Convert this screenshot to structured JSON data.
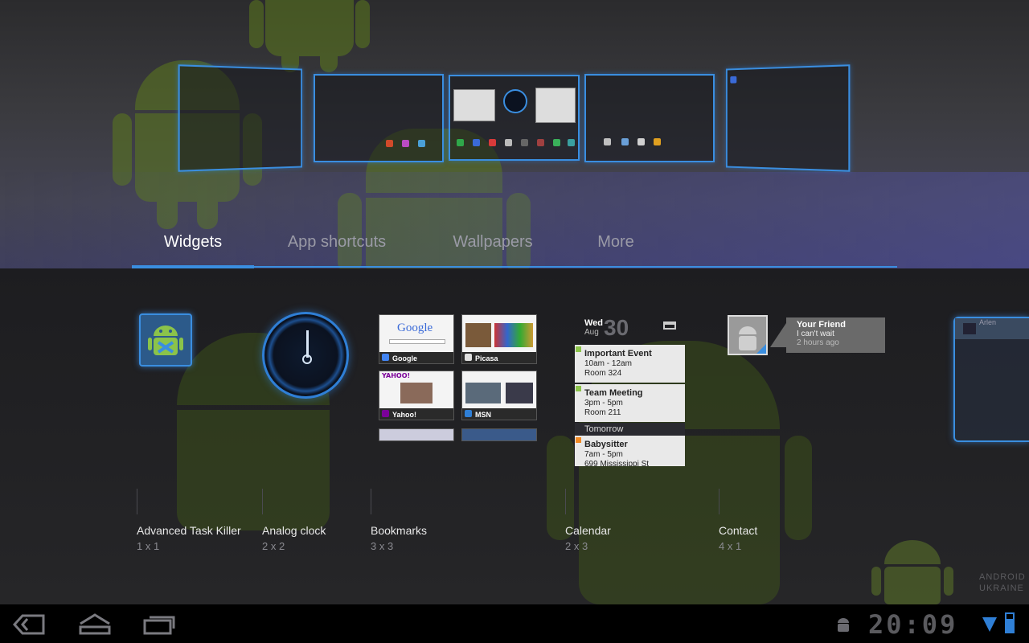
{
  "tabs": [
    {
      "label": "Widgets",
      "active": true
    },
    {
      "label": "App shortcuts",
      "active": false
    },
    {
      "label": "Wallpapers",
      "active": false
    },
    {
      "label": "More",
      "active": false
    }
  ],
  "widgets": [
    {
      "name": "Advanced Task Killer",
      "size": "1 x 1"
    },
    {
      "name": "Analog clock",
      "size": "2 x 2"
    },
    {
      "name": "Bookmarks",
      "size": "3 x 3"
    },
    {
      "name": "Calendar",
      "size": "2 x 3"
    },
    {
      "name": "Contact",
      "size": "4 x 1"
    }
  ],
  "bookmarks": [
    "Google",
    "Picasa",
    "Yahoo!",
    "MSN"
  ],
  "bookmark_preview_texts": {
    "google": "Google",
    "yahoo": "YAHOO!"
  },
  "calendar": {
    "day": "Wed",
    "month": "Aug",
    "date": "30",
    "events": [
      {
        "title": "Important Event",
        "time": "10am - 12am",
        "place": "Room 324",
        "color": "#8bc34a"
      },
      {
        "title": "Team Meeting",
        "time": "3pm - 5pm",
        "place": "Room 211",
        "color": "#8bc34a"
      },
      {
        "title": "Babysitter",
        "time": "7am - 5pm",
        "place": "699 Mississippi St",
        "color": "#f08a24"
      }
    ],
    "divider": "Tomorrow"
  },
  "contact": {
    "name": "Your Friend",
    "status": "I can't wait",
    "time": "2 hours ago"
  },
  "partial_widget_label": "Arlen",
  "watermark": {
    "line1": "ANDROID",
    "line2": "UKRAINE"
  },
  "status_bar": {
    "time": "20:09"
  },
  "colors": {
    "accent": "#3a8ee0",
    "android_green": "#8bc34a"
  },
  "icons": [
    "back-icon",
    "home-icon",
    "recent-apps-icon",
    "android-notification-icon",
    "wifi-icon",
    "battery-icon"
  ]
}
